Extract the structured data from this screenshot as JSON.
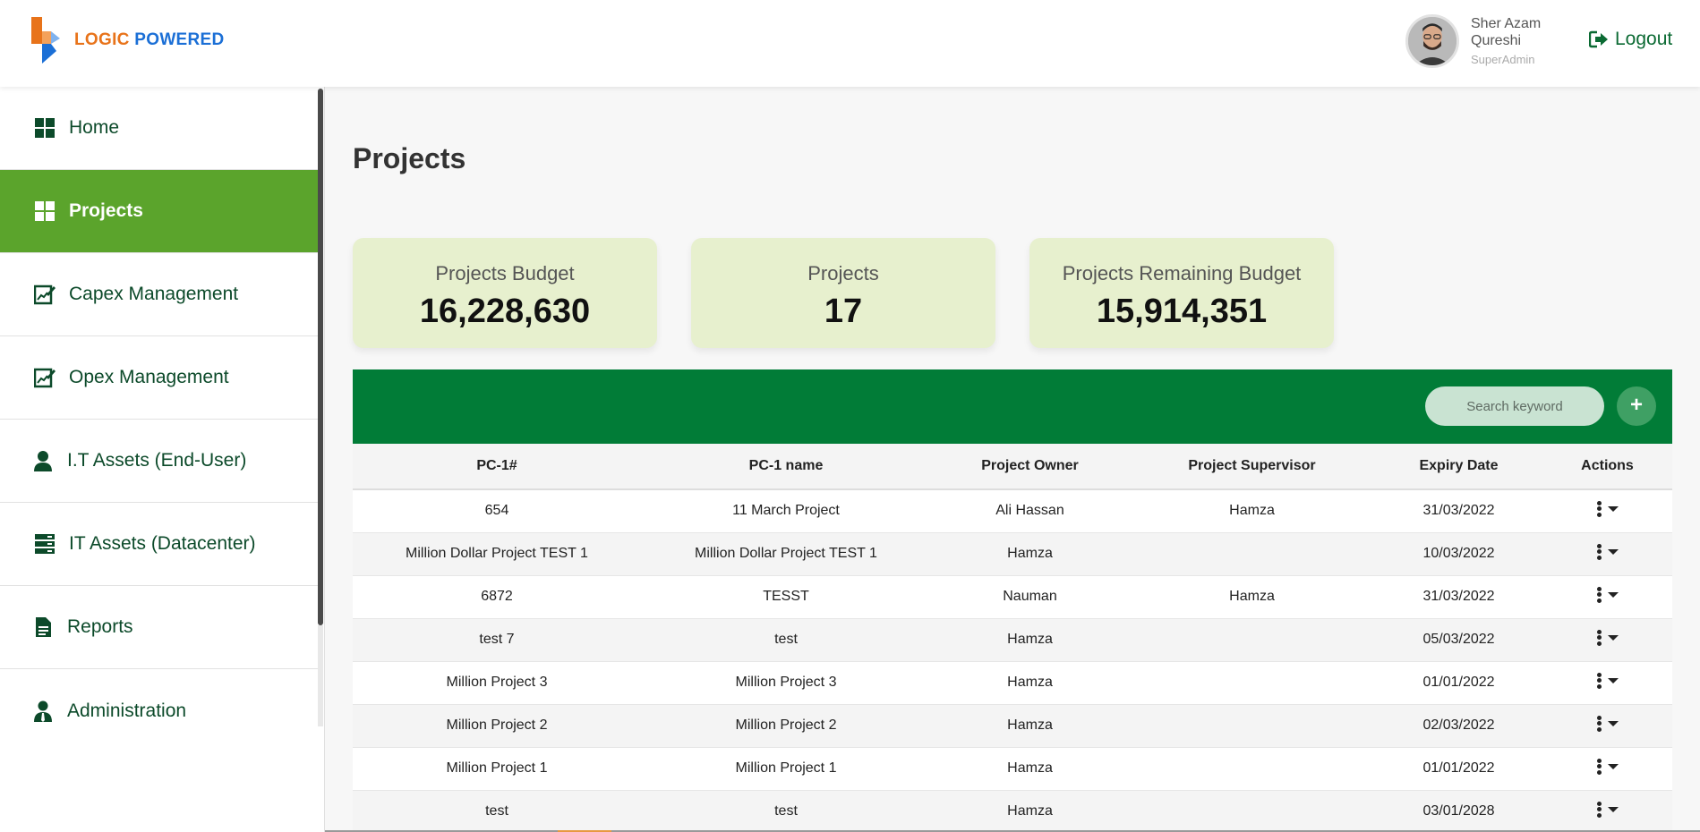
{
  "brand": {
    "word1": "LOGIC",
    "word2": "POWERED",
    "color_orange": "#e8731a",
    "color_blue": "#1b6fd6"
  },
  "user": {
    "name": "Sher Azam Qureshi",
    "role": "SuperAdmin",
    "avatar_icon": "user-avatar"
  },
  "header": {
    "logout_label": "Logout",
    "logout_icon": "logout-icon"
  },
  "sidebar": {
    "items": [
      {
        "label": "Home",
        "icon": "grid-icon"
      },
      {
        "label": "Projects",
        "icon": "grid-icon",
        "active": true
      },
      {
        "label": "Capex Management",
        "icon": "edit-chart-icon"
      },
      {
        "label": "Opex Management",
        "icon": "edit-chart-icon"
      },
      {
        "label": "I.T Assets (End-User)",
        "icon": "user-icon"
      },
      {
        "label": "IT Assets (Datacenter)",
        "icon": "server-icon"
      },
      {
        "label": "Reports",
        "icon": "document-icon"
      },
      {
        "label": "Administration",
        "icon": "admin-user-icon"
      }
    ]
  },
  "page": {
    "title": "Projects"
  },
  "cards": [
    {
      "label": "Projects Budget",
      "value": "16,228,630"
    },
    {
      "label": "Projects",
      "value": "17"
    },
    {
      "label": "Projects Remaining Budget",
      "value": "15,914,351"
    }
  ],
  "toolbar": {
    "search_placeholder": "Search keyword",
    "add_label": "+"
  },
  "table": {
    "columns": [
      "PC-1#",
      "PC-1 name",
      "Project Owner",
      "Project Supervisor",
      "Expiry Date",
      "Actions"
    ],
    "rows": [
      [
        "654",
        "11 March Project",
        "Ali Hassan",
        "Hamza",
        "31/03/2022"
      ],
      [
        "Million Dollar Project TEST 1",
        "Million Dollar Project TEST 1",
        "Hamza",
        "",
        "10/03/2022"
      ],
      [
        "6872",
        "TESST",
        "Nauman",
        "Hamza",
        "31/03/2022"
      ],
      [
        "test 7",
        "test",
        "Hamza",
        "",
        "05/03/2022"
      ],
      [
        "Million Project 3",
        "Million Project 3",
        "Hamza",
        "",
        "01/01/2022"
      ],
      [
        "Million Project 2",
        "Million Project 2",
        "Hamza",
        "",
        "02/03/2022"
      ],
      [
        "Million Project 1",
        "Million Project 1",
        "Hamza",
        "",
        "01/01/2022"
      ],
      [
        "test",
        "test",
        "Hamza",
        "",
        "03/01/2028"
      ]
    ]
  },
  "colors": {
    "accent_green": "#5ba42c",
    "bar_green": "#017c37",
    "card_bg": "#e7f0ce",
    "nav_text": "#0c4a2a"
  }
}
